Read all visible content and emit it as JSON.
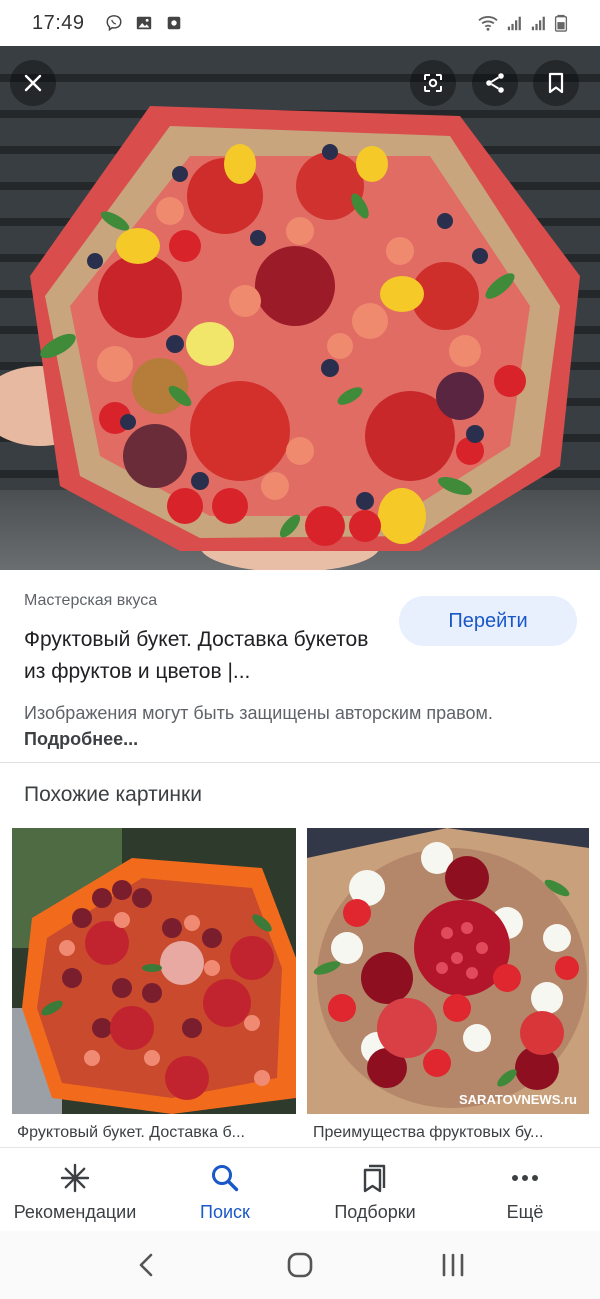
{
  "status_bar": {
    "time": "17:49",
    "left_icons": [
      "viber-icon",
      "gallery-icon",
      "screen-record-icon"
    ],
    "right_icons": [
      "wifi-icon",
      "signal-icon",
      "signal-icon",
      "battery-icon"
    ]
  },
  "hero": {
    "watermark": "",
    "buttons": [
      "close-icon",
      "lens-icon",
      "share-icon",
      "bookmark-icon"
    ]
  },
  "result": {
    "source": "Мастерская вкуса",
    "title": "Фруктовый букет. Доставка букетов из фруктов и цветов |...",
    "go_label": "Перейти",
    "copyright_text": "Изображения могут быть защищены авторским правом.",
    "more_label": "Подробнее..."
  },
  "similar": {
    "heading": "Похожие картинки",
    "items": [
      {
        "caption": "Фруктовый букет. Доставка б..."
      },
      {
        "caption": "Преимущества фруктовых бу...",
        "watermark": "SARATOVNEWS.ru"
      }
    ]
  },
  "bottom_nav": {
    "items": [
      {
        "label": "Рекомендации",
        "icon": "asterisk-icon",
        "active": false
      },
      {
        "label": "Поиск",
        "icon": "search-icon",
        "active": true
      },
      {
        "label": "Подборки",
        "icon": "collections-icon",
        "active": false
      },
      {
        "label": "Ещё",
        "icon": "more-icon",
        "active": false
      }
    ]
  },
  "colors": {
    "accent": "#1a57c8",
    "button_bg": "#e8f0fe",
    "secondary_text": "#5f6368"
  }
}
